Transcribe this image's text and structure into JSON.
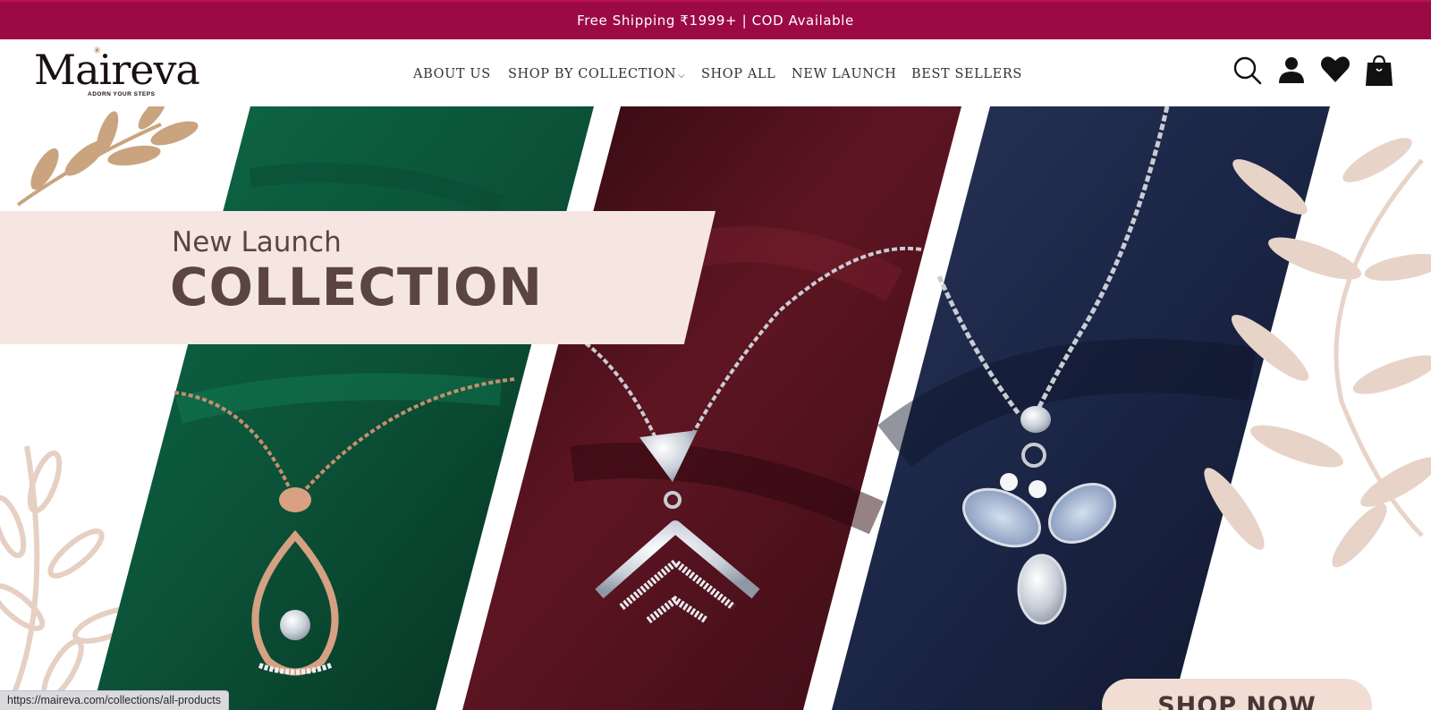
{
  "announcement": {
    "text": "Free Shipping ₹1999+ | COD Available"
  },
  "header": {
    "logo": {
      "wordmark": "Maireva",
      "tagline": "ADORN YOUR STEPS"
    },
    "nav": [
      {
        "label": "ABOUT US",
        "has_dropdown": false
      },
      {
        "label": "SHOP BY COLLECTION",
        "has_dropdown": true
      },
      {
        "label": "SHOP ALL",
        "has_dropdown": false
      },
      {
        "label": "NEW LAUNCH",
        "has_dropdown": false
      },
      {
        "label": "BEST SELLERS",
        "has_dropdown": false
      }
    ],
    "icons": [
      "search-icon",
      "account-icon",
      "wishlist-icon",
      "cart-icon"
    ]
  },
  "hero": {
    "headline_small": "New Launch",
    "headline_large": "COLLECTION",
    "cta_label": "SHOP NOW",
    "panel_colors": [
      "#0f5b3f",
      "#5c1420",
      "#1c2748"
    ],
    "accent_color": "#d9bfae"
  },
  "status_bar": {
    "url": "https://maireva.com/collections/all-products"
  },
  "colors": {
    "announcement_bg": "#9c0a46",
    "banner_bg": "#f5e6e1",
    "text_brown": "#5a4543"
  }
}
